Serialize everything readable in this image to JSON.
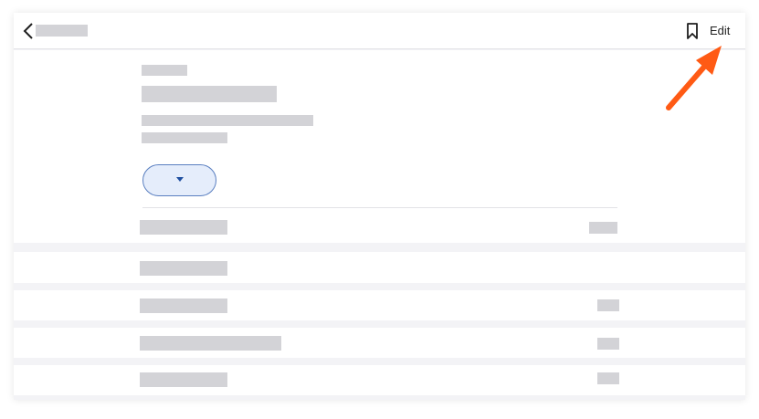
{
  "header": {
    "back_icon": "chevron-left-icon",
    "bookmark_icon": "bookmark-icon",
    "edit_label": "Edit"
  },
  "details": {
    "dropdown_icon": "caret-down-icon"
  },
  "annotation": {
    "arrow_color": "#ff5a14"
  },
  "colors": {
    "placeholder": "#d3d3d7",
    "dropdown_border": "#5a7fc0",
    "dropdown_fill": "#e5edfb",
    "caret": "#1f4fa0"
  }
}
